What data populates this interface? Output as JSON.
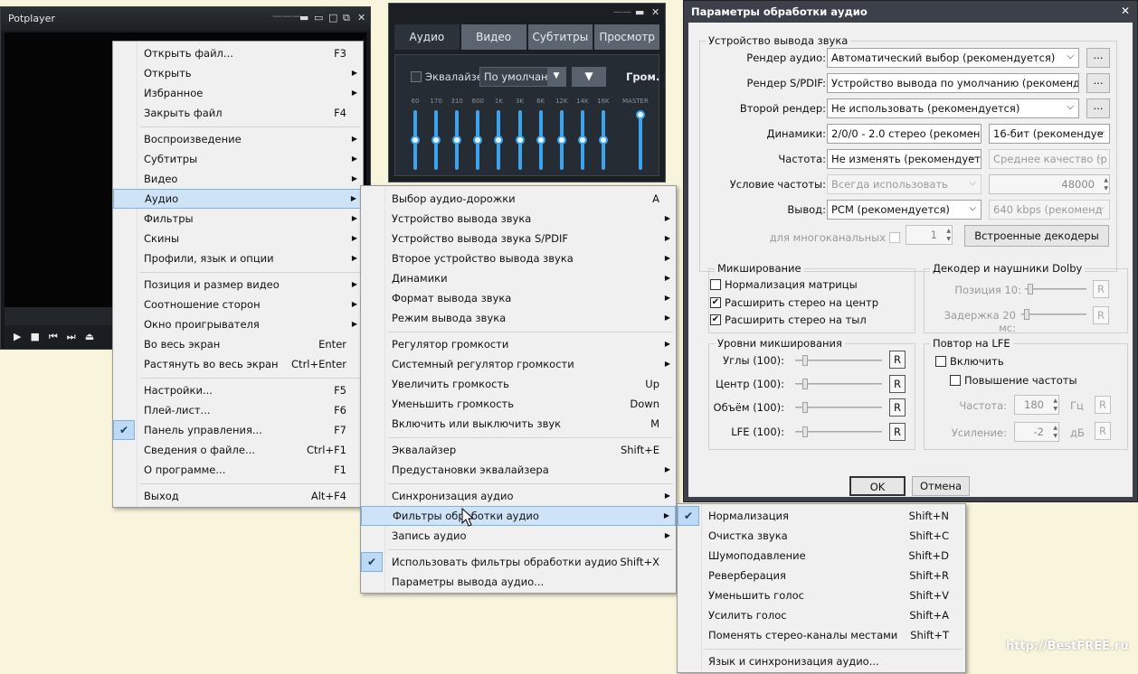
{
  "player": {
    "title": "Potplayer"
  },
  "eq": {
    "tabs": [
      "Аудио",
      "Видео",
      "Субтитры",
      "Просмотр"
    ],
    "eq_label": "Эквалайзер",
    "preset": "По умолчани",
    "vol_label": "Гром.",
    "master": "MASTER",
    "freqs": [
      "60",
      "170",
      "310",
      "600",
      "1K",
      "3K",
      "6K",
      "12K",
      "14K",
      "16K"
    ]
  },
  "main_menu": [
    {
      "label": "Открыть файл...",
      "shortcut": "F3"
    },
    {
      "label": "Открыть",
      "arrow": true
    },
    {
      "label": "Избранное",
      "arrow": true
    },
    {
      "label": "Закрыть файл",
      "shortcut": "F4"
    },
    {
      "label": "Воспроизведение",
      "arrow": true
    },
    {
      "label": "Субтитры",
      "arrow": true
    },
    {
      "label": "Видео",
      "arrow": true
    },
    {
      "label": "Аудио",
      "arrow": true
    },
    {
      "label": "Фильтры",
      "arrow": true
    },
    {
      "label": "Скины",
      "arrow": true
    },
    {
      "label": "Профили, язык и опции",
      "arrow": true
    },
    {
      "label": "Позиция и размер видео",
      "arrow": true
    },
    {
      "label": "Соотношение сторон",
      "arrow": true
    },
    {
      "label": "Окно проигрывателя",
      "arrow": true
    },
    {
      "label": "Во весь экран",
      "shortcut": "Enter"
    },
    {
      "label": "Растянуть во весь экран",
      "shortcut": "Ctrl+Enter"
    },
    {
      "label": "Настройки...",
      "shortcut": "F5"
    },
    {
      "label": "Плей-лист...",
      "shortcut": "F6"
    },
    {
      "label": "Панель управления...",
      "shortcut": "F7",
      "checked": true
    },
    {
      "label": "Сведения о файле...",
      "shortcut": "Ctrl+F1"
    },
    {
      "label": "О программе...",
      "shortcut": "F1"
    },
    {
      "label": "Выход",
      "shortcut": "Alt+F4"
    }
  ],
  "audio_menu": [
    {
      "label": "Выбор аудио-дорожки",
      "shortcut": "A"
    },
    {
      "label": "Устройство вывода звука",
      "arrow": true
    },
    {
      "label": "Устройство вывода звука S/PDIF",
      "arrow": true
    },
    {
      "label": "Второе устройство вывода звука",
      "arrow": true
    },
    {
      "label": "Динамики",
      "arrow": true
    },
    {
      "label": "Формат вывода звука",
      "arrow": true
    },
    {
      "label": "Режим вывода звука",
      "arrow": true
    },
    {
      "label": "Регулятор громкости",
      "arrow": true
    },
    {
      "label": "Системный регулятор громкости",
      "arrow": true
    },
    {
      "label": "Увеличить громкость",
      "shortcut": "Up"
    },
    {
      "label": "Уменьшить громкость",
      "shortcut": "Down"
    },
    {
      "label": "Включить или выключить звук",
      "shortcut": "M"
    },
    {
      "label": "Эквалайзер",
      "shortcut": "Shift+E"
    },
    {
      "label": "Предустановки эквалайзера",
      "arrow": true
    },
    {
      "label": "Синхронизация аудио",
      "arrow": true
    },
    {
      "label": "Фильтры обработки аудио",
      "arrow": true
    },
    {
      "label": "Запись аудио",
      "arrow": true
    },
    {
      "label": "Использовать фильтры обработки аудио",
      "shortcut": "Shift+X",
      "checked": true
    },
    {
      "label": "Параметры вывода аудио..."
    }
  ],
  "filter_menu": [
    {
      "label": "Нормализация",
      "shortcut": "Shift+N",
      "checked": true
    },
    {
      "label": "Очистка звука",
      "shortcut": "Shift+C"
    },
    {
      "label": "Шумоподавление",
      "shortcut": "Shift+D"
    },
    {
      "label": "Реверберация",
      "shortcut": "Shift+R"
    },
    {
      "label": "Уменьшить голос",
      "shortcut": "Shift+V"
    },
    {
      "label": "Усилить голос",
      "shortcut": "Shift+A"
    },
    {
      "label": "Поменять стерео-каналы местами",
      "shortcut": "Shift+T"
    },
    {
      "label": "Язык и синхронизация аудио..."
    }
  ],
  "dialog": {
    "title": "Параметры обработки аудио",
    "output_group": "Устройство вывода звука",
    "render_label": "Рендер аудио:",
    "render_value": "Автоматический выбор (рекомендуется)",
    "spdif_label": "Рендер S/PDIF:",
    "spdif_value": "Устройство вывода по умолчанию (рекоменд",
    "second_label": "Второй рендер:",
    "second_value": "Не использовать (рекомендуется)",
    "browse": "...",
    "speakers_label": "Динамики:",
    "speakers_value": "2/0/0 - 2.0 стерео (рекомен",
    "bits_value": "16-бит (рекомендуе",
    "freq_label": "Частота:",
    "freq_value": "Не изменять (рекомендуется",
    "quality_value": "Среднее качество (р",
    "freq_cond_label": "Условие частоты:",
    "freq_cond_value": "Всегда использовать",
    "freq_num": "48000",
    "output_label": "Вывод:",
    "output_value": "PCM (рекомендуется)",
    "bitrate_value": "640 kbps (рекоменд",
    "multich_label": "для многоканальных",
    "multich_num": "1",
    "decoders_btn": "Встроенные декодеры",
    "mix_group": "Микширование",
    "mix_norm": "Нормализация матрицы",
    "mix_center": "Расширить стерео на центр",
    "mix_rear": "Расширить стерео на тыл",
    "dolby_group": "Декодер и наушники Dolby",
    "dolby_pos": "Позиция 10:",
    "dolby_delay": "Задержка 20 мс:",
    "levels_group": "Уровни микширования",
    "lvl_corners": "Углы (100):",
    "lvl_center": "Центр (100):",
    "lvl_volume": "Объём (100):",
    "lvl_lfe": "LFE (100):",
    "r": "R",
    "lfe_group": "Повтор на LFE",
    "lfe_enable": "Включить",
    "lfe_boost": "Повышение частоты",
    "lfe_freq": "Частота:",
    "lfe_freq_val": "180",
    "lfe_hz": "Гц",
    "lfe_gain": "Усиление:",
    "lfe_gain_val": "-2",
    "lfe_db": "дБ",
    "ok": "OK",
    "cancel": "Отмена"
  },
  "watermark": "http://BestFREE.ru"
}
